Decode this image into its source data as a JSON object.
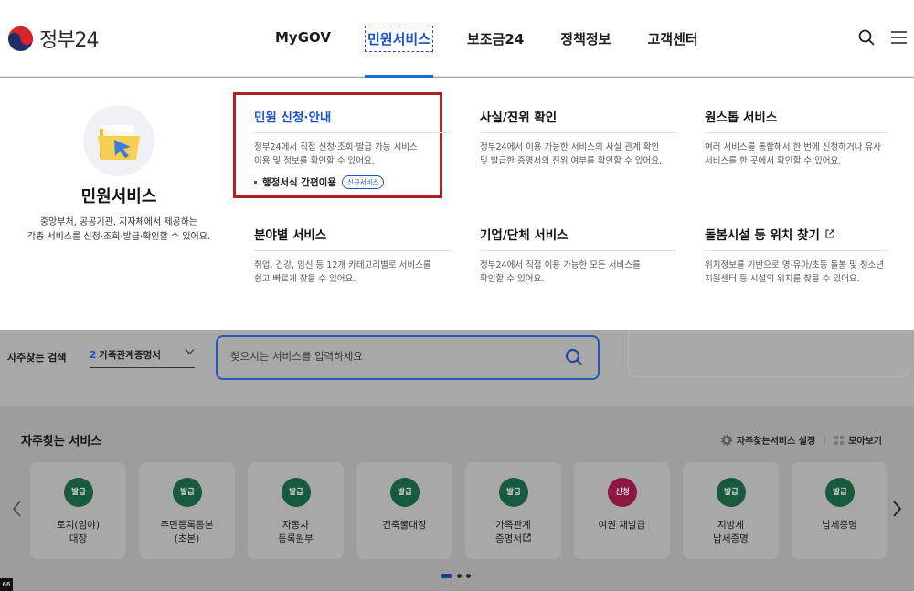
{
  "header": {
    "logo_text": "정부24",
    "nav": [
      {
        "label": "MyGOV",
        "active": false
      },
      {
        "label": "민원서비스",
        "active": true
      },
      {
        "label": "보조금24",
        "active": false
      },
      {
        "label": "정책정보",
        "active": false
      },
      {
        "label": "고객센터",
        "active": false
      }
    ],
    "icons": [
      "search-icon",
      "menu-icon"
    ]
  },
  "megamenu": {
    "title": "민원서비스",
    "description": "중앙부처, 공공기관, 지자체에서 제공하는\n각종 서비스를 신청·조회·발급·확인할 수 있어요.",
    "columns": [
      {
        "title": "민원 신청·안내",
        "desc": "정부24에서 직접 신청·조회·발급 가능 서비스\n이용 및 정보를 확인할 수 있어요.",
        "sub": "행정서식 간편이용",
        "badge": "신규서비스",
        "highlighted": true
      },
      {
        "title": "사실/진위 확인",
        "desc": "정부24에서 이용 가능한 서비스의 사실 관계 확인\n및 발급한 증명서의 진위 여부를 확인할 수 있어요."
      },
      {
        "title": "원스톱 서비스",
        "desc": "여러 서비스를 통합해서 한 번에 신청하거나 유사\n서비스를 한 곳에서 확인할 수 있어요."
      },
      {
        "title": "분야별 서비스",
        "desc": "취업, 건강, 임신 등 12개 카테고리별로 서비스를\n쉽고 빠르게 찾을 수 있어요."
      },
      {
        "title": "기업/단체 서비스",
        "desc": "정부24에서 직접 이용 가능한 모든 서비스를\n확인할 수 있어요."
      },
      {
        "title": "돌봄시설 등 위치 찾기",
        "desc": "위치정보를 기반으로 영·유아/초등 돌봄 및 청소년\n지원센터 등 시설의 위치를 찾을 수 있어요.",
        "external": true
      }
    ]
  },
  "search": {
    "keyword_label": "자주찾는 검색",
    "keyword_num": "2",
    "keyword_value": "가족관계증명서",
    "placeholder": "찾으시는 서비스를 입력하세요"
  },
  "frequent": {
    "title": "자주찾는 서비스",
    "settings_label": "자주찾는서비스 설정",
    "collect_label": "모아보기",
    "cards": [
      {
        "tag": "발급",
        "label": "토지(임야)\n대장",
        "tag_color": "#175a3d"
      },
      {
        "tag": "발급",
        "label": "주민등록등본\n(초본)",
        "tag_color": "#175a3d"
      },
      {
        "tag": "발급",
        "label": "자동차\n등록원부",
        "tag_color": "#175a3d"
      },
      {
        "tag": "발급",
        "label": "건축물대장",
        "tag_color": "#175a3d"
      },
      {
        "tag": "발급",
        "label": "가족관계\n증명서",
        "external": true,
        "tag_color": "#175a3d"
      },
      {
        "tag": "신청",
        "label": "여권 재발급",
        "tag_color": "#8b1742"
      },
      {
        "tag": "발급",
        "label": "지방세\n납세증명",
        "tag_color": "#175a3d"
      },
      {
        "tag": "발급",
        "label": "납세증명",
        "tag_color": "#175a3d"
      }
    ],
    "pagination": {
      "pages": 3,
      "current": 1
    }
  },
  "corner_badge": "66"
}
